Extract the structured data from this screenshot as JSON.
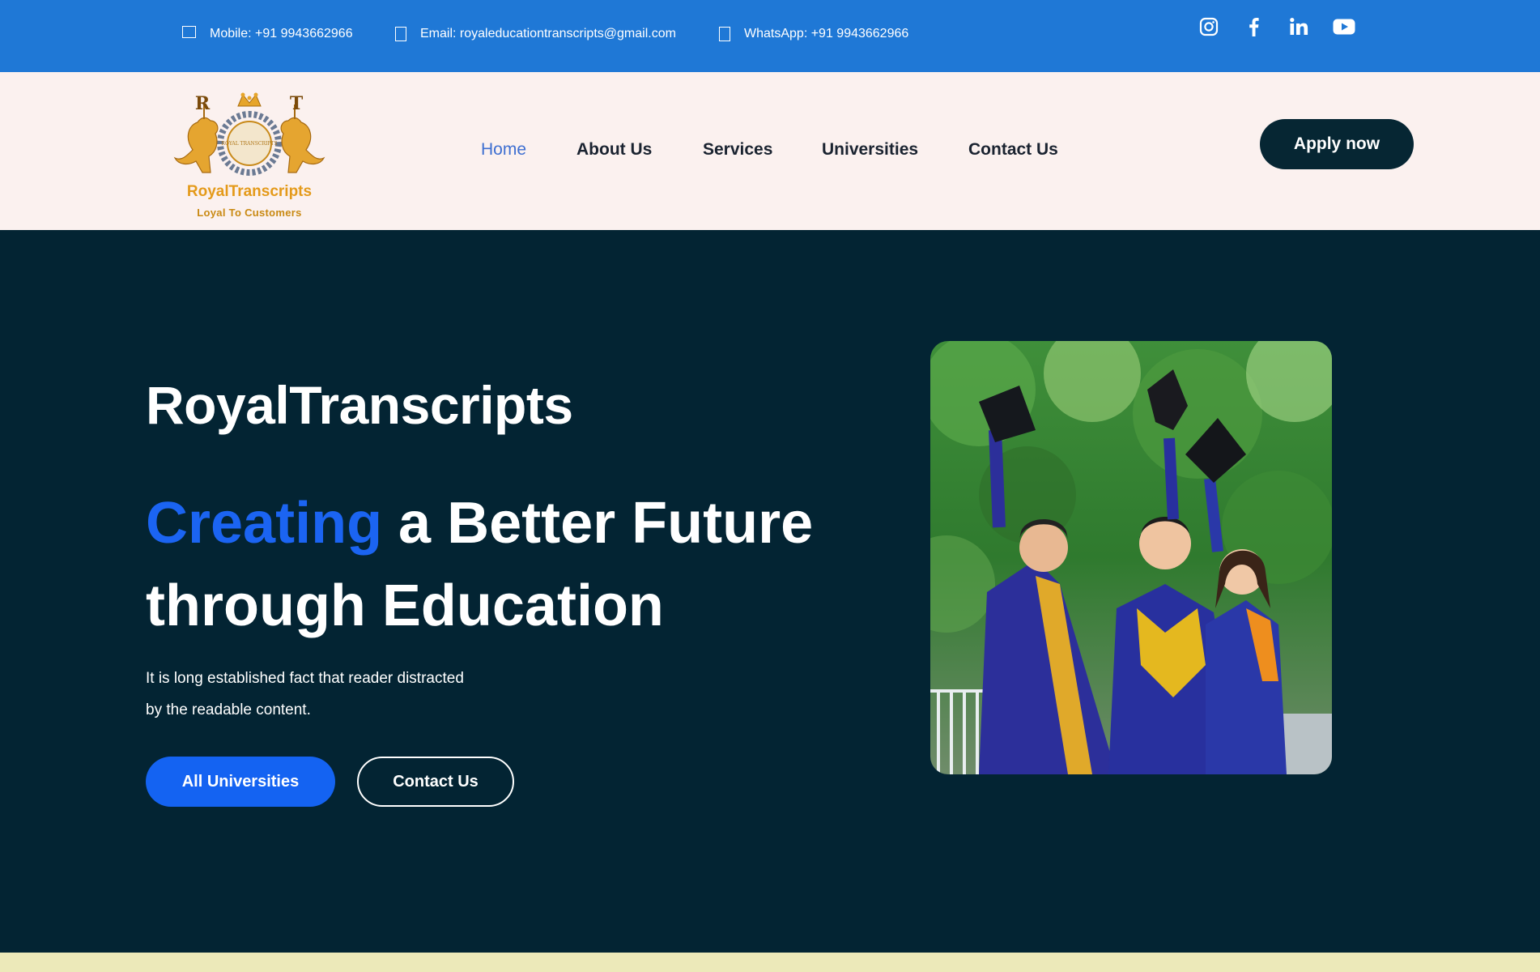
{
  "topbar": {
    "mobile": "Mobile: +91 9943662966",
    "email": "Email: royaleducationtranscripts@gmail.com",
    "whatsapp": "WhatsApp: +91 9943662966",
    "socials": [
      "instagram-icon",
      "facebook-icon",
      "linkedin-icon",
      "youtube-icon"
    ],
    "background": "#1f78d6"
  },
  "header": {
    "logo_name": "RoyalTranscripts",
    "logo_tagline": "Loyal To Customers",
    "logo_seal_text": "ROYAL TRANSCRIPTS",
    "nav": [
      "Home",
      "About Us",
      "Services",
      "Universities",
      "Contact Us"
    ],
    "active_nav": "Home",
    "apply_label": "Apply now"
  },
  "hero": {
    "brand": "RoyalTranscripts",
    "title_accent": "Creating",
    "title_rest_line1": " a Better Future",
    "title_line2": "through Education",
    "description_line1": "It is long established fact that reader distracted",
    "description_line2": "by the readable content.",
    "primary_button": "All Universities",
    "secondary_button": "Contact Us",
    "image_subject": "graduates-photo"
  },
  "colors": {
    "hero_bg": "#032433",
    "accent_blue": "#1b64f2",
    "header_bg": "#fbf1ef",
    "logo_gold": "#e49a1a",
    "bottom_strip": "#ece9b9"
  }
}
